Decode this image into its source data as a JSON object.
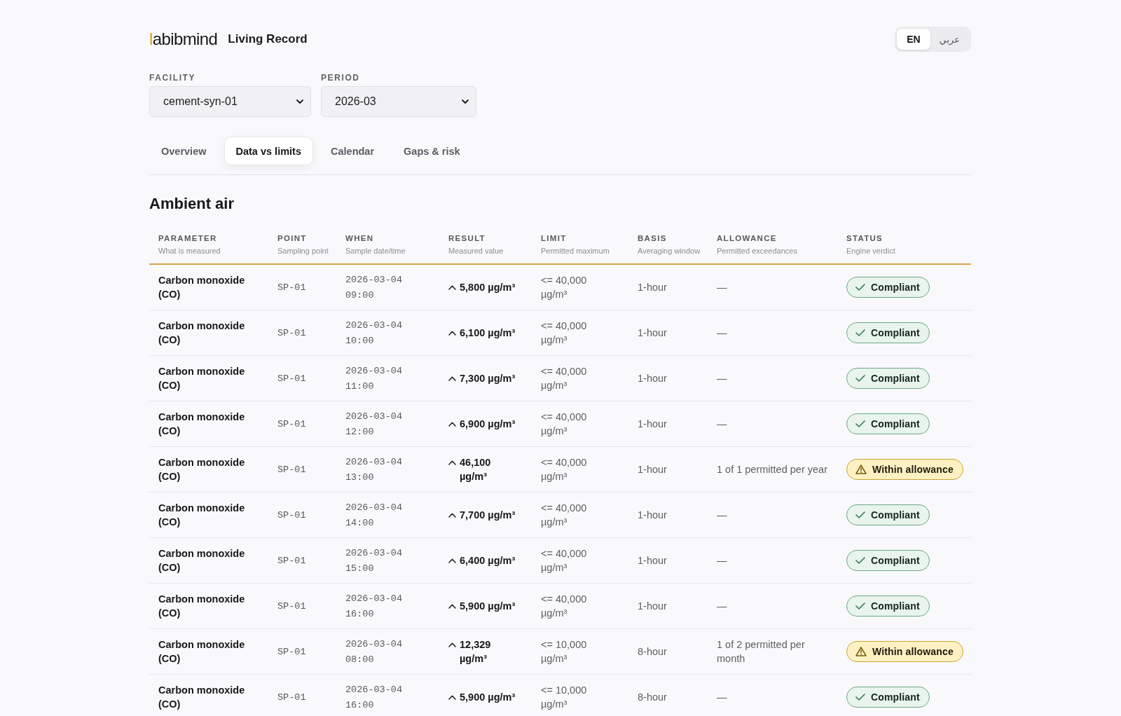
{
  "header": {
    "logo": "labibmind",
    "title": "Living Record"
  },
  "language_toggle": [
    {
      "label": "EN",
      "selected": true
    },
    {
      "label": "عربي",
      "selected": false
    }
  ],
  "filters": [
    {
      "label": "FACILITY",
      "value": "cement-syn-01"
    },
    {
      "label": "PERIOD",
      "value": "2026-03"
    }
  ],
  "tabs": [
    {
      "label": "Overview",
      "selected": false
    },
    {
      "label": "Data vs limits",
      "selected": true
    },
    {
      "label": "Calendar",
      "selected": false
    },
    {
      "label": "Gaps & risk",
      "selected": false
    }
  ],
  "section": {
    "title": "Ambient air",
    "table": {
      "columns": [
        {
          "label": "PARAMETER",
          "subtitle": "What is measured"
        },
        {
          "label": "POINT",
          "subtitle": "Sampling point"
        },
        {
          "label": "WHEN",
          "subtitle": "Sample date/time"
        },
        {
          "label": "RESULT",
          "subtitle": "Measured value"
        },
        {
          "label": "LIMIT",
          "subtitle": "Permitted maximum"
        },
        {
          "label": "BASIS",
          "subtitle": "Averaging window"
        },
        {
          "label": "ALLOWANCE",
          "subtitle": "Permitted exceedances"
        },
        {
          "label": "STATUS",
          "subtitle": "Engine verdict"
        }
      ],
      "rows": [
        {
          "parameter": "Carbon monoxide (CO)",
          "point": "SP-01",
          "when": "2026-03-04 09:00",
          "result": "5,800 µg/m³",
          "limit": "<= 40,000 µg/m³",
          "basis": "1-hour",
          "allowance": "—",
          "status": {
            "label": "Compliant",
            "kind": "compliant"
          }
        },
        {
          "parameter": "Carbon monoxide (CO)",
          "point": "SP-01",
          "when": "2026-03-04 10:00",
          "result": "6,100 µg/m³",
          "limit": "<= 40,000 µg/m³",
          "basis": "1-hour",
          "allowance": "—",
          "status": {
            "label": "Compliant",
            "kind": "compliant"
          }
        },
        {
          "parameter": "Carbon monoxide (CO)",
          "point": "SP-01",
          "when": "2026-03-04 11:00",
          "result": "7,300 µg/m³",
          "limit": "<= 40,000 µg/m³",
          "basis": "1-hour",
          "allowance": "—",
          "status": {
            "label": "Compliant",
            "kind": "compliant"
          }
        },
        {
          "parameter": "Carbon monoxide (CO)",
          "point": "SP-01",
          "when": "2026-03-04 12:00",
          "result": "6,900 µg/m³",
          "limit": "<= 40,000 µg/m³",
          "basis": "1-hour",
          "allowance": "—",
          "status": {
            "label": "Compliant",
            "kind": "compliant"
          }
        },
        {
          "parameter": "Carbon monoxide (CO)",
          "point": "SP-01",
          "when": "2026-03-04 13:00",
          "result": "46,100 µg/m³",
          "limit": "<= 40,000 µg/m³",
          "basis": "1-hour",
          "allowance": "1 of 1 permitted per year",
          "status": {
            "label": "Within allowance",
            "kind": "allowance"
          }
        },
        {
          "parameter": "Carbon monoxide (CO)",
          "point": "SP-01",
          "when": "2026-03-04 14:00",
          "result": "7,700 µg/m³",
          "limit": "<= 40,000 µg/m³",
          "basis": "1-hour",
          "allowance": "—",
          "status": {
            "label": "Compliant",
            "kind": "compliant"
          }
        },
        {
          "parameter": "Carbon monoxide (CO)",
          "point": "SP-01",
          "when": "2026-03-04 15:00",
          "result": "6,400 µg/m³",
          "limit": "<= 40,000 µg/m³",
          "basis": "1-hour",
          "allowance": "—",
          "status": {
            "label": "Compliant",
            "kind": "compliant"
          }
        },
        {
          "parameter": "Carbon monoxide (CO)",
          "point": "SP-01",
          "when": "2026-03-04 16:00",
          "result": "5,900 µg/m³",
          "limit": "<= 40,000 µg/m³",
          "basis": "1-hour",
          "allowance": "—",
          "status": {
            "label": "Compliant",
            "kind": "compliant"
          }
        },
        {
          "parameter": "Carbon monoxide (CO)",
          "point": "SP-01",
          "when": "2026-03-04 08:00",
          "result": "12,329 µg/m³",
          "limit": "<= 10,000 µg/m³",
          "basis": "8-hour",
          "allowance": "1 of 2 permitted per month",
          "status": {
            "label": "Within allowance",
            "kind": "allowance"
          }
        },
        {
          "parameter": "Carbon monoxide (CO)",
          "point": "SP-01",
          "when": "2026-03-04 16:00",
          "result": "5,900 µg/m³",
          "limit": "<= 10,000 µg/m³",
          "basis": "8-hour",
          "allowance": "—",
          "status": {
            "label": "Compliant",
            "kind": "compliant"
          }
        }
      ]
    }
  }
}
